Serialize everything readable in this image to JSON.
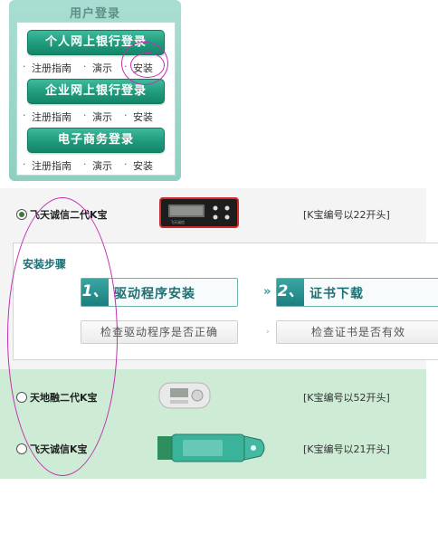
{
  "login": {
    "title": "用户登录",
    "personal_button": "个人网上银行登录",
    "enterprise_button": "企业网上银行登录",
    "ecommerce_button": "电子商务登录",
    "links": {
      "register_guide": "注册指南",
      "demo": "演示",
      "install": "安装",
      "separator": "·"
    }
  },
  "tokens": [
    {
      "label": "飞天诚信二代K宝",
      "code": "[K宝编号以22开头]",
      "selected": true
    },
    {
      "label": "天地融二代K宝",
      "code": "[K宝编号以52开头]",
      "selected": false
    },
    {
      "label": "飞天诚信K宝",
      "code": "[K宝编号以21开头]",
      "selected": false
    }
  ],
  "install_steps": {
    "title": "安装步骤",
    "step1_number": "1、",
    "step1_label": "驱动程序安装",
    "arrow": "»",
    "step2_number": "2、",
    "step2_label": "证书下载",
    "check_driver": "检查驱动程序是否正确",
    "check_cert": "检查证书是否有效",
    "dot": "›"
  },
  "device_screen": {
    "brand": "飞天诚信"
  },
  "colors": {
    "accent_green": "#1f9a7b",
    "panel_mint": "#a9ded2",
    "steps_teal": "#1e6f74",
    "token_bg_green": "#cdebd5",
    "annotation_magenta": "#c22fb2"
  }
}
